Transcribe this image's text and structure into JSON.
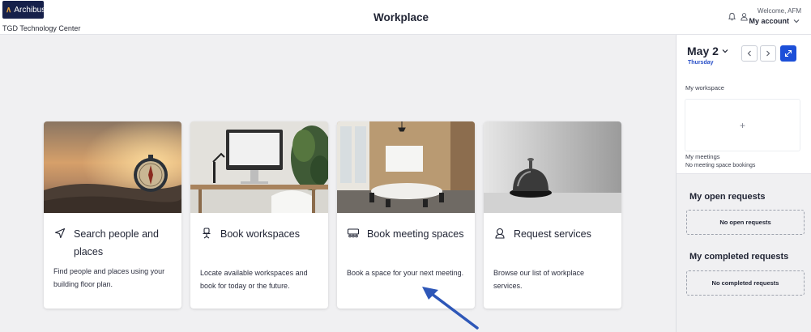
{
  "header": {
    "logo_text": "Archibus",
    "site_name": "TGD Technology Center",
    "title": "Workplace",
    "icons": [
      "bell-icon",
      "user-icon"
    ],
    "welcome": "Welcome, AFM",
    "account_label": "My account"
  },
  "cards": [
    {
      "title": "Search people and places",
      "description": "Find people and places using your building floor plan.",
      "icon": "navigation-arrow-icon",
      "image": "compass-on-rock"
    },
    {
      "title": "Book workspaces",
      "description": "Locate available workspaces and book for today or the future.",
      "icon": "desk-chair-icon",
      "image": "desk-with-monitor"
    },
    {
      "title": "Book meeting spaces",
      "description": "Book a space for your next meeting.",
      "icon": "meeting-room-icon",
      "image": "conference-room"
    },
    {
      "title": "Request services",
      "description": "Browse our list of workplace services.",
      "icon": "service-bell-icon",
      "image": "service-bell"
    }
  ],
  "panel": {
    "date": "May 2",
    "day": "Thursday",
    "my_workspace_label": "My workspace",
    "add_symbol": "+",
    "my_meetings_label": "My meetings",
    "no_meetings": "No meeting space bookings",
    "open_requests_title": "My open requests",
    "no_open_requests": "No open requests",
    "completed_requests_title": "My completed requests",
    "no_completed_requests": "No completed requests"
  },
  "colors": {
    "accent": "#1c4fd8",
    "logo_bg": "#16204a",
    "background": "#f0f0f2",
    "annotation_arrow": "#2e57b8"
  }
}
